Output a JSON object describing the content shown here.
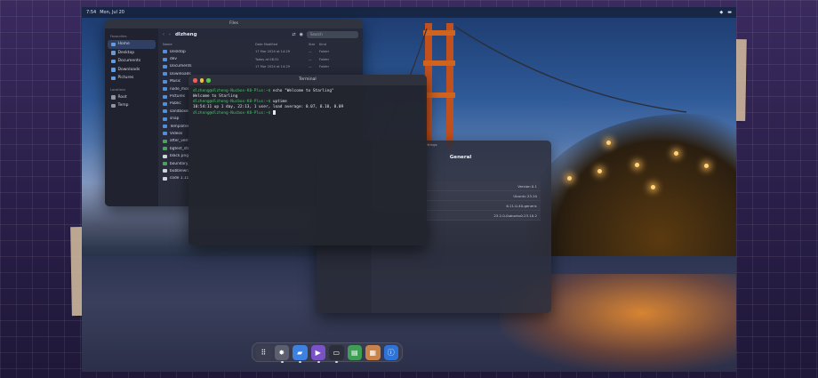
{
  "topbar": {
    "time": "7:54",
    "date": "Mon, Jul 20"
  },
  "files": {
    "window_title": "Files",
    "sidebar_section": "Favourites",
    "sidebar_items": [
      {
        "label": "Home"
      },
      {
        "label": "Desktop"
      },
      {
        "label": "Documents"
      },
      {
        "label": "Downloads"
      },
      {
        "label": "Pictures"
      }
    ],
    "locations_section": "Locations",
    "locations": [
      {
        "label": "Root"
      },
      {
        "label": "Temp"
      }
    ],
    "path_title": "dlzheng",
    "search_placeholder": "Search",
    "columns": {
      "name": "Name",
      "date": "Date Modified",
      "size": "Size",
      "kind": "Kind"
    },
    "rows": [
      {
        "name": "Desktop",
        "date": "17 Mar 2024 at 14:29",
        "size": "—",
        "kind": "Folder",
        "type": "folder"
      },
      {
        "name": "dev",
        "date": "Today at 08:31",
        "size": "—",
        "kind": "Folder",
        "type": "folder"
      },
      {
        "name": "Documents",
        "date": "17 Mar 2024 at 14:29",
        "size": "—",
        "kind": "Folder",
        "type": "folder"
      },
      {
        "name": "Downloads",
        "date": "",
        "size": "",
        "kind": "",
        "type": "folder"
      },
      {
        "name": "Music",
        "date": "",
        "size": "",
        "kind": "",
        "type": "folder"
      },
      {
        "name": "node_modu",
        "date": "",
        "size": "",
        "kind": "",
        "type": "folder"
      },
      {
        "name": "Pictures",
        "date": "",
        "size": "",
        "kind": "",
        "type": "folder"
      },
      {
        "name": "Public",
        "date": "",
        "size": "",
        "kind": "",
        "type": "folder"
      },
      {
        "name": "sandboxes",
        "date": "",
        "size": "",
        "kind": "",
        "type": "folder"
      },
      {
        "name": "snap",
        "date": "",
        "size": "",
        "kind": "",
        "type": "folder"
      },
      {
        "name": "Templates",
        "date": "",
        "size": "",
        "kind": "",
        "type": "folder"
      },
      {
        "name": "Videos",
        "date": "",
        "size": "",
        "kind": "",
        "type": "folder"
      },
      {
        "name": "after_verifi",
        "date": "",
        "size": "",
        "kind": "",
        "type": "green"
      },
      {
        "name": "bgtest_star",
        "date": "",
        "size": "",
        "kind": "",
        "type": "green"
      },
      {
        "name": "black.png",
        "date": "",
        "size": "",
        "kind": "",
        "type": "doc"
      },
      {
        "name": "boundary_",
        "date": "",
        "size": "",
        "kind": "",
        "type": "green"
      },
      {
        "name": "bubblewra",
        "date": "",
        "size": "",
        "kind": "",
        "type": "doc"
      },
      {
        "name": "code 1.11",
        "date": "",
        "size": "",
        "kind": "",
        "type": "doc"
      }
    ]
  },
  "terminal": {
    "title": "Terminal",
    "prompt1": "dlzheng@dlzheng-Nucbox-K8-Plus:~$",
    "cmd1": " echo \"Welcome to Starling\"",
    "out1": "Welcome to Starling",
    "prompt2": "dlzheng@dlzheng-Nucbox-K8-Plus:~$",
    "cmd2": " uptime",
    "out2": " 10:54:11 up 1 day, 22:13,  1 user,  load average: 0.07, 0.10, 0.09",
    "prompt3": "dlzheng@dlzheng-Nucbox-K8-Plus:~$"
  },
  "settings": {
    "title": "Settings",
    "header": "General",
    "info": [
      "Version 0.1",
      "Ubuntu 23.10",
      "6.11.0-40-generic",
      "23.2.0-0ubuntu0.23.10.2"
    ]
  },
  "dock": {
    "apps": [
      {
        "name": "apps-grid-icon",
        "glyph": "⠿",
        "color": "#3b3e4e"
      },
      {
        "name": "settings-gear-icon",
        "glyph": "✸",
        "color": "#5c5f70"
      },
      {
        "name": "files-folder-icon",
        "glyph": "▰",
        "color": "#3d82e0"
      },
      {
        "name": "media-player-icon",
        "glyph": "▶",
        "color": "#7a52c8"
      },
      {
        "name": "terminal-icon",
        "glyph": "▭",
        "color": "#2c2e3a"
      },
      {
        "name": "notes-icon",
        "glyph": "▤",
        "color": "#3f9d55"
      },
      {
        "name": "calculator-icon",
        "glyph": "▦",
        "color": "#c9834a"
      },
      {
        "name": "info-icon",
        "glyph": "ⓘ",
        "color": "#2f73d6"
      }
    ]
  },
  "colors": {
    "accent": "#3d82e0",
    "prompt": "#46c46b"
  }
}
